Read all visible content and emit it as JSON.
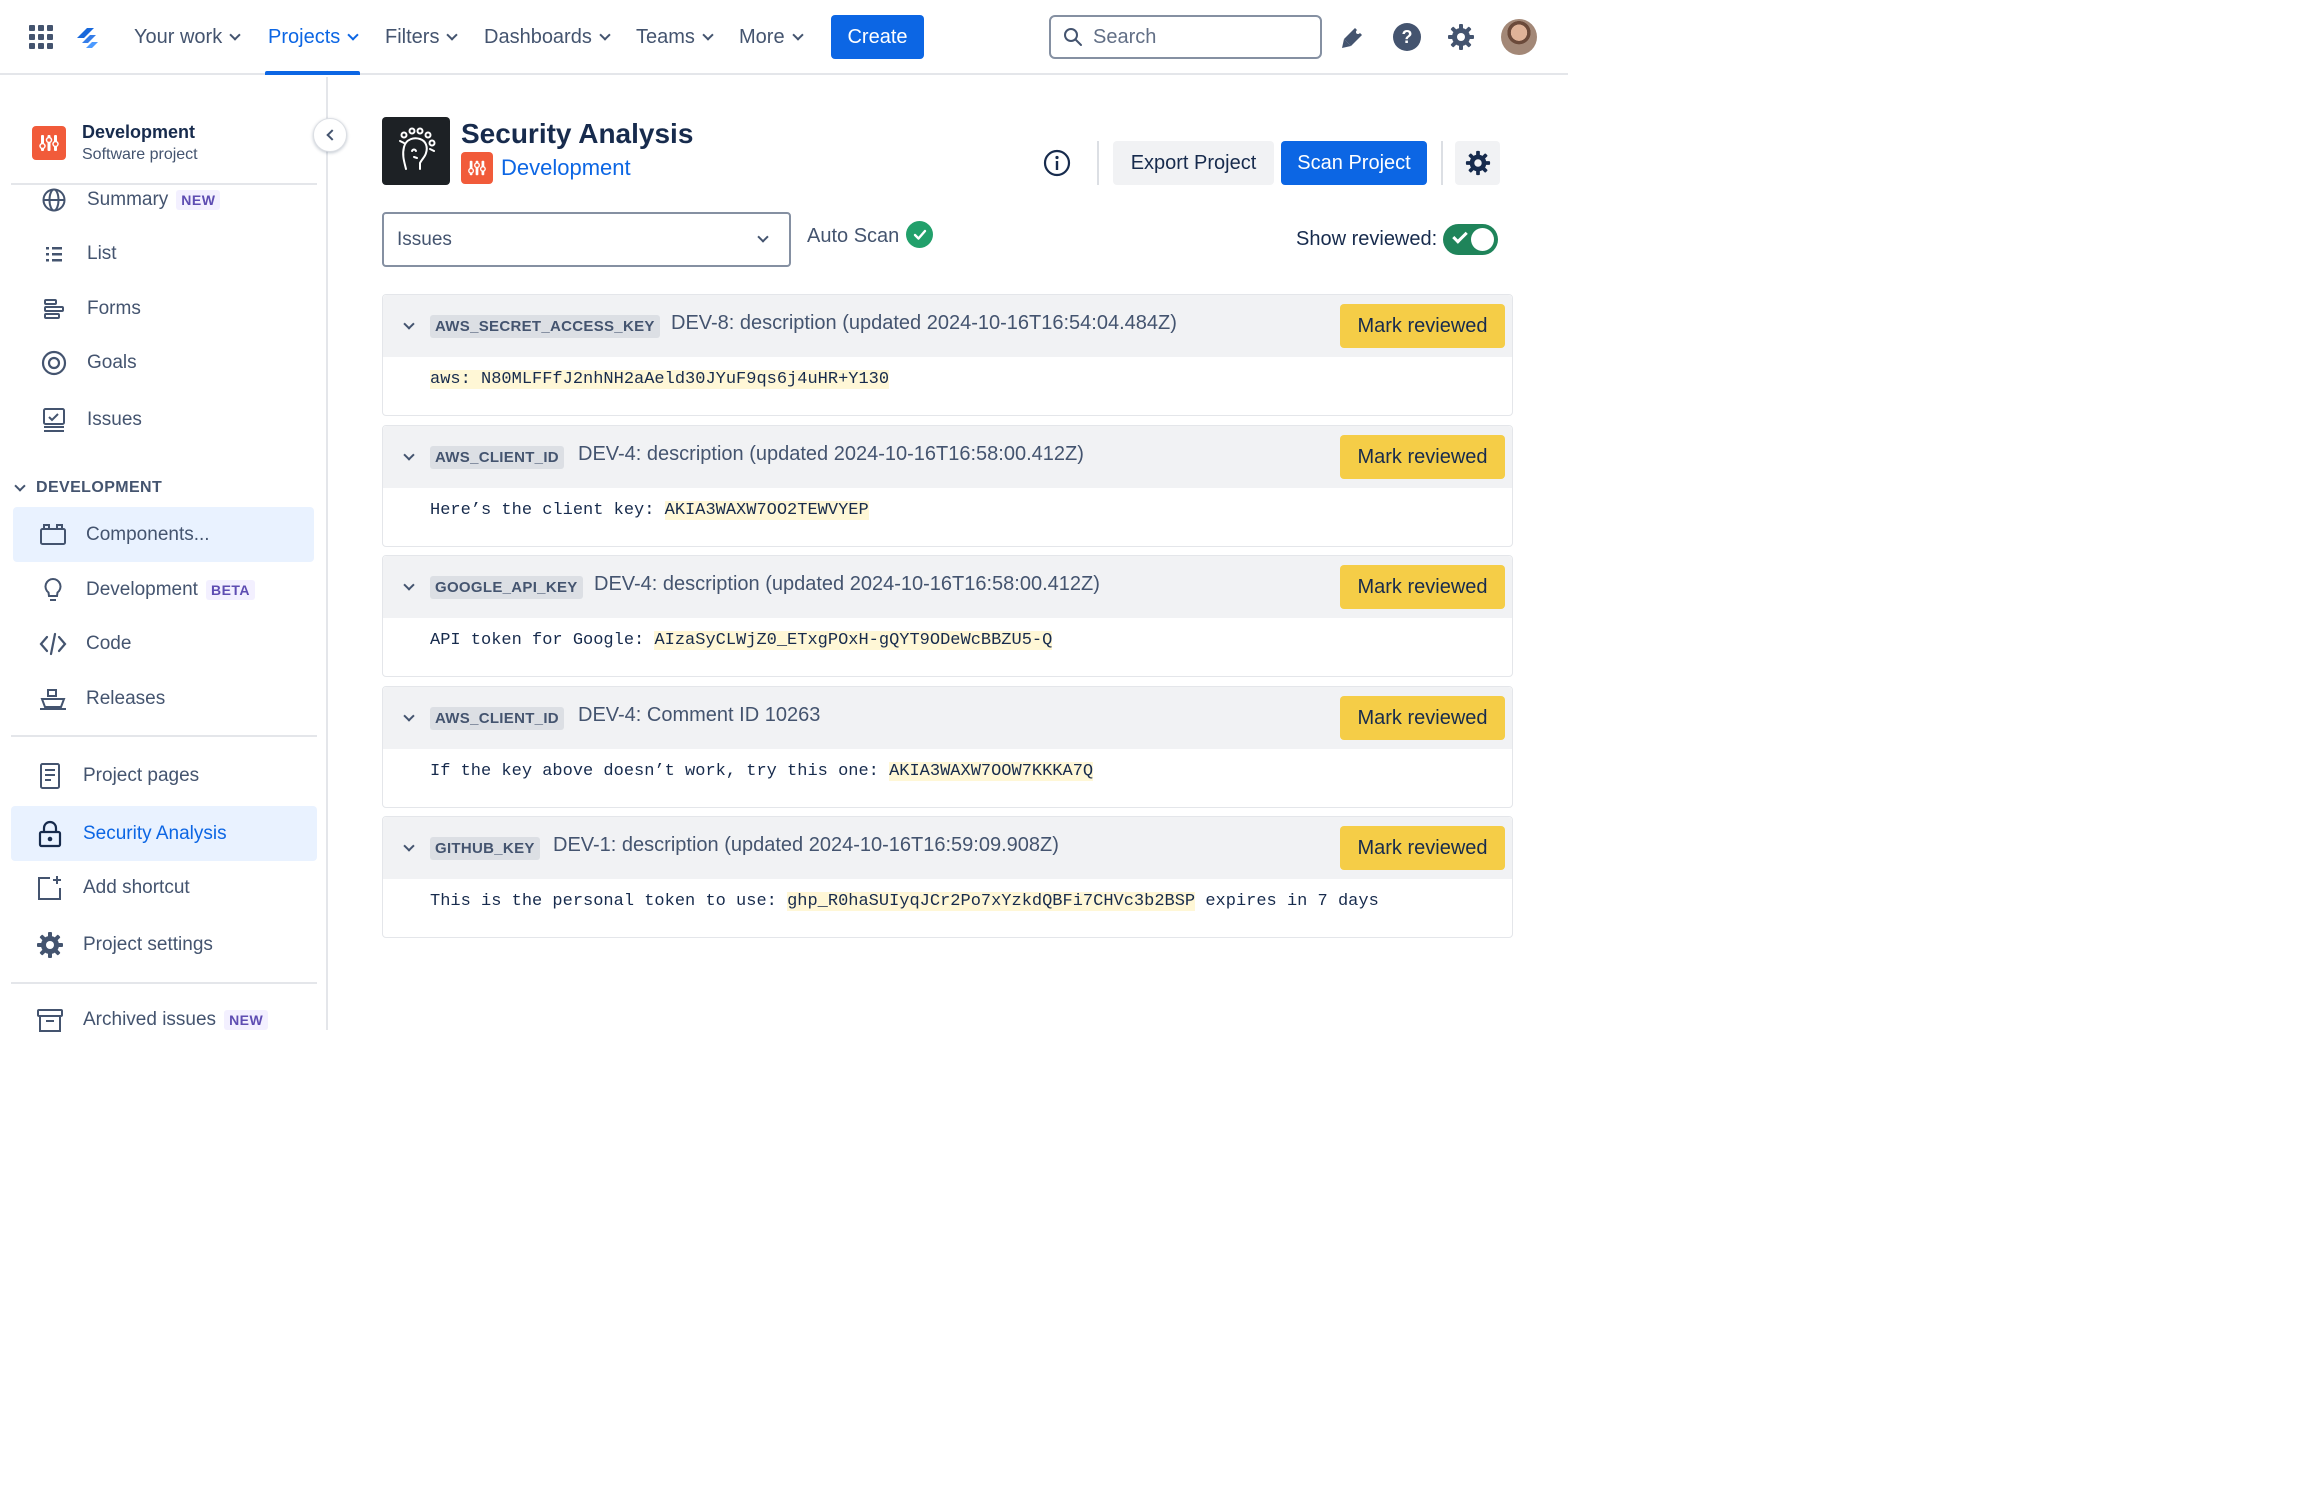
{
  "topnav": {
    "items": [
      {
        "label": "Your work"
      },
      {
        "label": "Projects"
      },
      {
        "label": "Filters"
      },
      {
        "label": "Dashboards"
      },
      {
        "label": "Teams"
      },
      {
        "label": "More"
      }
    ],
    "active_item": "Projects",
    "create_label": "Create",
    "search_placeholder": "Search",
    "icons": [
      "app-switcher-icon",
      "jira-logo-icon",
      "notifications-icon",
      "help-icon",
      "settings-icon",
      "avatar"
    ]
  },
  "sidebar": {
    "project_name": "Development",
    "project_type": "Software project",
    "items": [
      {
        "label": "Summary",
        "badge": "NEW",
        "icon": "globe-icon"
      },
      {
        "label": "List",
        "icon": "list-icon"
      },
      {
        "label": "Forms",
        "icon": "forms-icon"
      },
      {
        "label": "Goals",
        "icon": "goals-icon"
      },
      {
        "label": "Issues",
        "icon": "issues-icon"
      }
    ],
    "group_label": "DEVELOPMENT",
    "group_items": [
      {
        "label": "Components...",
        "icon": "components-icon"
      },
      {
        "label": "Development",
        "badge": "BETA",
        "icon": "lightbulb-icon"
      },
      {
        "label": "Code",
        "icon": "code-icon"
      },
      {
        "label": "Releases",
        "icon": "ship-icon"
      }
    ],
    "bottom_items": [
      {
        "label": "Project pages",
        "icon": "page-icon"
      },
      {
        "label": "Security Analysis",
        "icon": "lock-icon"
      },
      {
        "label": "Add shortcut",
        "icon": "add-shortcut-icon"
      },
      {
        "label": "Project settings",
        "icon": "gear-icon"
      }
    ],
    "archived": {
      "label": "Archived issues",
      "badge": "NEW",
      "icon": "archive-icon"
    }
  },
  "header": {
    "title": "Security Analysis",
    "subtitle": "Development",
    "export_label": "Export Project",
    "scan_label": "Scan Project"
  },
  "filters": {
    "select_value": "Issues",
    "auto_scan_label": "Auto Scan",
    "show_reviewed_label": "Show reviewed:",
    "show_reviewed_on": true
  },
  "findings": [
    {
      "key_type": "AWS_SECRET_ACCESS_KEY",
      "title": "DEV-8: description (updated 2024-10-16T16:54:04.484Z)",
      "prefix": "",
      "secret": "aws: N80MLFFfJ2nhNH2aAeld30JYuF9qs6j4uHR+Y130",
      "suffix": "",
      "button": "Mark reviewed"
    },
    {
      "key_type": "AWS_CLIENT_ID",
      "title": "DEV-4: description (updated 2024-10-16T16:58:00.412Z)",
      "prefix": "Here’s the client key: ",
      "secret": "AKIA3WAXW7OO2TEWVYEP",
      "suffix": "",
      "button": "Mark reviewed"
    },
    {
      "key_type": "GOOGLE_API_KEY",
      "title": "DEV-4: description (updated 2024-10-16T16:58:00.412Z)",
      "prefix": "API token for Google: ",
      "secret": "AIzaSyCLWjZ0_ETxgPOxH-gQYT9ODeWcBBZU5-Q",
      "suffix": "",
      "button": "Mark reviewed"
    },
    {
      "key_type": "AWS_CLIENT_ID",
      "title": "DEV-4: Comment ID 10263",
      "prefix": "If the key above doesn’t work, try this one: ",
      "secret": "AKIA3WAXW7OOW7KKKA7Q",
      "suffix": "",
      "button": "Mark reviewed"
    },
    {
      "key_type": "GITHUB_KEY",
      "title": "DEV-1: description (updated 2024-10-16T16:59:09.908Z)",
      "prefix": "This is the personal token to use: ",
      "secret": "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",
      "suffix": " expires in 7 days",
      "button": "Mark reviewed"
    }
  ],
  "colors": {
    "brand_blue": "#0c66e4",
    "mark_button": "#f5cd47",
    "secret_highlight": "#fff7d6",
    "toggle_on": "#1f845a",
    "project_logo": "#f15b3a"
  }
}
